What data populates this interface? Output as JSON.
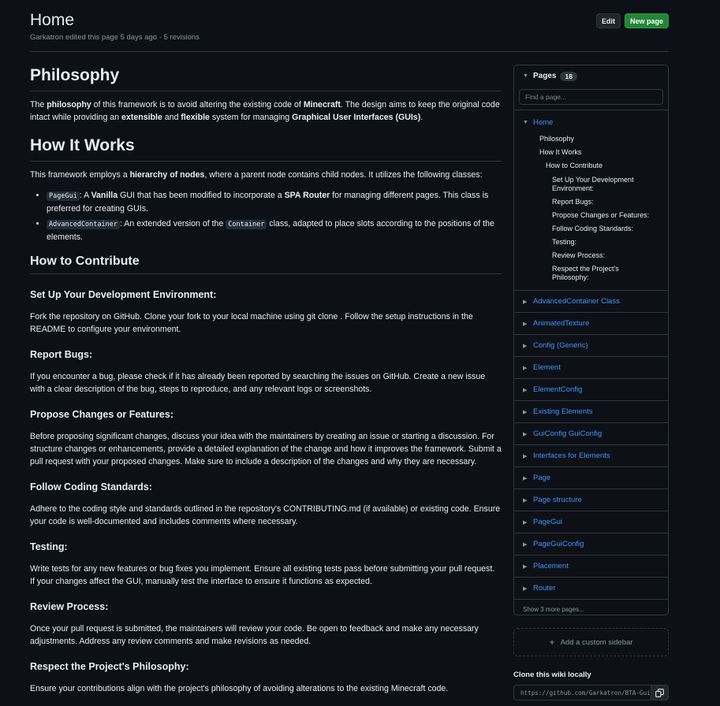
{
  "page": {
    "title": "Home",
    "meta": "Garkatron edited this page 5 days ago · 5 revisions",
    "edit_label": "Edit",
    "new_page_label": "New page"
  },
  "article": {
    "h_philosophy": "Philosophy",
    "philosophy": [
      "The ",
      "philosophy",
      " of this framework is to avoid altering the existing code of ",
      "Minecraft",
      ". The design aims to keep the original code intact while providing an ",
      "extensible",
      " and ",
      "flexible",
      " system for managing ",
      "Graphical User Interfaces (GUIs)",
      "."
    ],
    "h_how": "How It Works",
    "how": [
      "This framework employs a ",
      "hierarchy of nodes",
      ", where a parent node contains child nodes. It utilizes the following classes:"
    ],
    "li1": {
      "code": "PageGui",
      "a": ": A ",
      "b1": "Vanilla",
      "c": " GUI that has been modified to incorporate a ",
      "b2": "SPA Router",
      "d": " for managing different pages. This class is preferred for creating GUIs."
    },
    "li2": {
      "code": "AdvancedContainer",
      "a": ": An extended version of the ",
      "code2": "Container",
      "b": " class, adapted to place slots according to the positions of the elements."
    },
    "h_contrib": "How to Contribute",
    "sections": [
      {
        "h": "Set Up Your Development Environment:",
        "p": "Fork the repository on GitHub. Clone your fork to your local machine using git clone . Follow the setup instructions in the README to configure your environment."
      },
      {
        "h": "Report Bugs:",
        "p": "If you encounter a bug, please check if it has already been reported by searching the issues on GitHub. Create a new issue with a clear description of the bug, steps to reproduce, and any relevant logs or screenshots."
      },
      {
        "h": "Propose Changes or Features:",
        "p": "Before proposing significant changes, discuss your idea with the maintainers by creating an issue or starting a discussion. For structure changes or enhancements, provide a detailed explanation of the change and how it improves the framework. Submit a pull request with your proposed changes. Make sure to include a description of the changes and why they are necessary."
      },
      {
        "h": "Follow Coding Standards:",
        "p": "Adhere to the coding style and standards outlined in the repository's CONTRIBUTING.md (if available) or existing code. Ensure your code is well-documented and includes comments where necessary."
      },
      {
        "h": "Testing:",
        "p": "Write tests for any new features or bug fixes you implement. Ensure all existing tests pass before submitting your pull request. If your changes affect the GUI, manually test the interface to ensure it functions as expected."
      },
      {
        "h": "Review Process:",
        "p": "Once your pull request is submitted, the maintainers will review your code. Be open to feedback and make any necessary adjustments. Address any review comments and make revisions as needed."
      },
      {
        "h": "Respect the Project's Philosophy:",
        "p": "Ensure your contributions align with the project's philosophy of avoiding alterations to the existing Minecraft code."
      }
    ]
  },
  "sidebar": {
    "pages_label": "Pages",
    "pages_count": "18",
    "find_placeholder": "Find a page...",
    "home": "Home",
    "toc": [
      {
        "text": "Philosophy",
        "level": 1
      },
      {
        "text": "How It Works",
        "level": 1
      },
      {
        "text": "How to Contribute",
        "level": 2
      },
      {
        "text": "Set Up Your Development Environment:",
        "level": 3
      },
      {
        "text": "Report Bugs:",
        "level": 3
      },
      {
        "text": "Propose Changes or Features:",
        "level": 3
      },
      {
        "text": "Follow Coding Standards:",
        "level": 3
      },
      {
        "text": "Testing:",
        "level": 3
      },
      {
        "text": "Review Process:",
        "level": 3
      },
      {
        "text": "Respect the Project's Philosophy:",
        "level": 3
      }
    ],
    "pages": [
      "AdvancedContainer Class",
      "AnimatedTexture",
      "Config (Generic)",
      "Element",
      "ElementConfig",
      "Existing Elements",
      "GuiConfig GuiConfig",
      "Interfaces for Elements",
      "Page",
      "Page structure",
      "PageGui",
      "PageGuiConfig",
      "Placement",
      "Router"
    ],
    "more": "Show 3 more pages...",
    "add_custom": "Add a custom sidebar",
    "clone_label": "Clone this wiki locally",
    "clone_url": "https://github.com/Garkatron/BTA-Gui"
  },
  "colors": {
    "bg": "#0d1117",
    "link": "#4493f8",
    "primary_btn": "#238636",
    "border": "#30363d",
    "muted": "#8b949e"
  },
  "icons": [
    "chevron-down-icon",
    "chevron-right-icon",
    "plus-icon",
    "copy-icon"
  ]
}
